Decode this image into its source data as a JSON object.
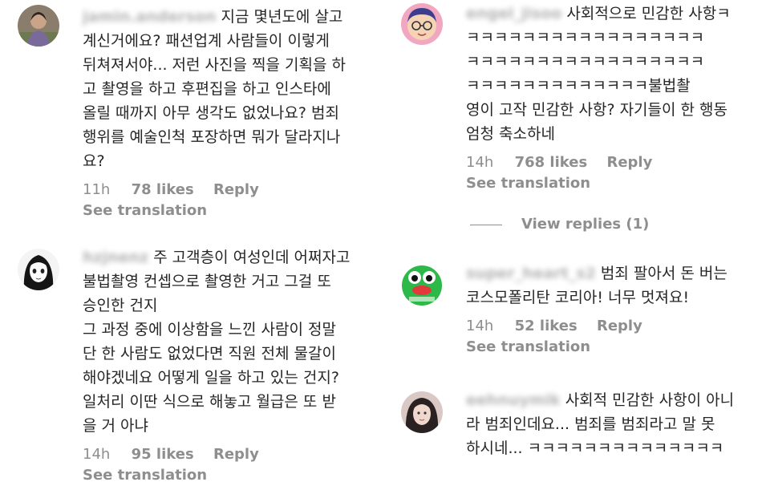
{
  "left_column": {
    "comments": [
      {
        "username": "jamin.anderson",
        "text": "지금 몇년도에 살고\n계신거에요? 패션업계 사람들이 이렇게\n뒤쳐져서야... 저런 사진을 찍을 기획을 하\n고 촬영을 하고 후편집을 하고 인스타에\n올릴 때까지 아무 생각도 없었나요? 범죄\n행위를 예술인척 포장하면 뭐가 달라지나\n요?",
        "time": "11h",
        "likes": "78 likes",
        "reply": "Reply",
        "see_translation": "See translation"
      },
      {
        "username": "hzjnenz",
        "text": "주 고객층이 여성인데 어쩌자고\n불법촬영 컨셉으로 촬영한 거고 그걸 또\n승인한 건지\n그 과정 중에 이상함을 느낀 사람이 정말\n단 한 사람도 없었다면 직원 전체 물갈이\n해야겠네요 어떻게 일을 하고 있는 건지?\n일처리 이딴 식으로 해놓고 월급은 또 받\n을 거 아냐",
        "time": "14h",
        "likes": "95 likes",
        "reply": "Reply",
        "see_translation": "See translation"
      }
    ]
  },
  "right_column": {
    "comments": [
      {
        "username": "engel_jisoo",
        "text": "사회적으로 민감한 사항ㅋ\nㅋㅋㅋㅋㅋㅋㅋㅋㅋㅋㅋㅋㅋㅋㅋㅋㅋ\nㅋㅋㅋㅋㅋㅋㅋㅋㅋㅋㅋㅋㅋㅋㅋㅋㅋ\nㅋㅋㅋㅋㅋㅋㅋㅋㅋㅋㅋㅋㅋ불법촬\n영이 고작 민감한 사항? 자기들이 한 행동\n엄청 축소하네",
        "time": "14h",
        "likes": "768 likes",
        "reply": "Reply",
        "see_translation": "See translation",
        "view_replies": "View replies (1)"
      },
      {
        "username": "super_heart_s2",
        "text": "범죄 팔아서 돈 버는\n코스모폴리탄 코리아! 너무 멋져요!",
        "time": "14h",
        "likes": "52 likes",
        "reply": "Reply",
        "see_translation": "See translation"
      },
      {
        "username": "eehnuymik",
        "text": "사회적 민감한 사항이 아니\n라 범죄인데요... 범죄를 범죄라고 말 못\n하시네... ㅋㅋㅋㅋㅋㅋㅋㅋㅋㅋㅋㅋㅋㅋ"
      }
    ]
  },
  "colors": {
    "text": "#262626",
    "meta": "#8e8e8e",
    "background": "#ffffff"
  }
}
